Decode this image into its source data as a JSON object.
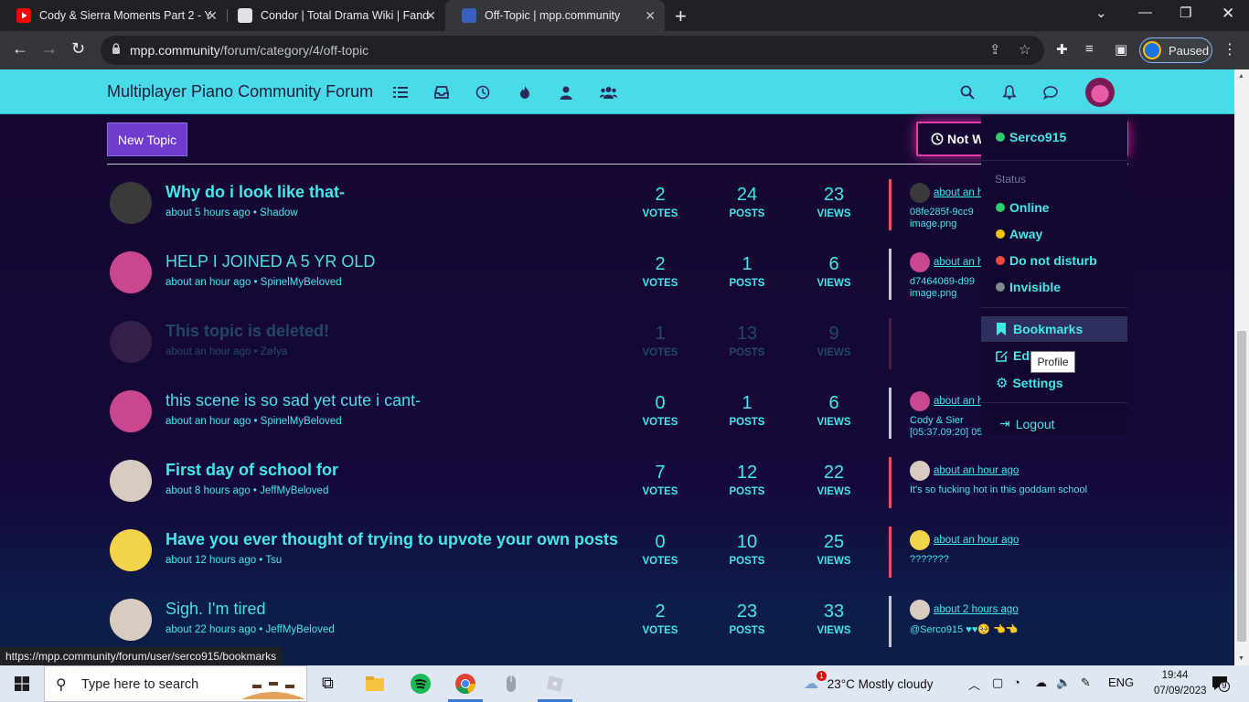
{
  "browser": {
    "tabs": [
      {
        "title": "Cody & Sierra Moments Part 2 - Y",
        "favicon": "youtube-icon",
        "active": false
      },
      {
        "title": "Condor | Total Drama Wiki | Fand",
        "favicon": "fandom-icon",
        "active": false
      },
      {
        "title": "Off-Topic | mpp.community",
        "favicon": "mpp-icon",
        "active": true
      }
    ],
    "url_host": "mpp.community",
    "url_path": "/forum/category/4/off-topic",
    "profile_label": "Paused",
    "status_url": "https://mpp.community/forum/user/serco915/bookmarks"
  },
  "site": {
    "brand": "Multiplayer Piano Community Forum",
    "accent": "#4adbe9",
    "link_color": "#45e6e8"
  },
  "toolbar": {
    "new_topic": "New Topic",
    "watch_label": "Not W"
  },
  "topics": [
    {
      "title": "Why do i look like that-",
      "meta": "about 5 hours ago • Shadow",
      "votes": "2",
      "posts": "24",
      "views": "23",
      "bar": "#e8505b",
      "last_time": "about an h",
      "last_text1": "08fe285f-9cc9",
      "last_text2": "image.png",
      "avatar": "#3a3a3a"
    },
    {
      "title": "HELP I JOINED A 5 YR OLD",
      "meta": "about an hour ago • SpinelMyBeloved",
      "votes": "2",
      "posts": "1",
      "views": "6",
      "bar": "#c8c8d4",
      "last_time": "about an h",
      "last_text1": "d7464069-d99",
      "last_text2": "image.png",
      "avatar": "#c8478f"
    },
    {
      "title": "This topic is deleted!",
      "meta": "about an hour ago • Zøfya",
      "votes": "1",
      "posts": "13",
      "views": "9",
      "bar": "#e8505b",
      "last_time": "",
      "last_text1": "",
      "last_text2": "",
      "avatar": "#8a5a7a"
    },
    {
      "title": "this scene is so sad yet cute i cant-",
      "meta": "about an hour ago • SpinelMyBeloved",
      "votes": "0",
      "posts": "1",
      "views": "6",
      "bar": "#c8c8d4",
      "last_time": "about an h",
      "last_text1": "Cody & Sier",
      "last_text2": "[05:37.09:20] 05",
      "avatar": "#c8478f"
    },
    {
      "title": "First day of school for",
      "meta": "about 8 hours ago • JeffMyBeloved",
      "votes": "7",
      "posts": "12",
      "views": "22",
      "bar": "#e8505b",
      "last_time": "about an hour ago",
      "last_text1": "It's so fucking hot in this goddam school",
      "last_text2": "",
      "avatar": "#d9cbc0"
    },
    {
      "title": "Have you ever thought of trying to upvote your own posts",
      "meta": "about 12 hours ago • Tsu",
      "votes": "0",
      "posts": "10",
      "views": "25",
      "bar": "#e8505b",
      "last_time": "about an hour ago",
      "last_text1": "???????",
      "last_text2": "",
      "avatar": "#f2d34a"
    },
    {
      "title": "Sigh. I'm tired",
      "meta": "about 22 hours ago • JeffMyBeloved",
      "votes": "2",
      "posts": "23",
      "views": "33",
      "bar": "#c8c8d4",
      "last_time": "about 2 hours ago",
      "last_text1": "@Serco915 ♥♥🥺 👈👈",
      "last_text2": "",
      "avatar": "#d9cbc0"
    }
  ],
  "stat_labels": {
    "votes": "VOTES",
    "posts": "POSTS",
    "views": "VIEWS"
  },
  "menu": {
    "username": "Serco915",
    "status_heading": "Status",
    "online": "Online",
    "away": "Away",
    "dnd": "Do not disturb",
    "invisible": "Invisible",
    "bookmarks": "Bookmarks",
    "edit": "Edi",
    "settings": "Settings",
    "logout": "Logout",
    "tooltip": "Profile"
  },
  "taskbar": {
    "search_placeholder": "Type here to search",
    "weather": "23°C  Mostly cloudy",
    "weather_badge": "1",
    "lang": "ENG",
    "time": "19:44",
    "date": "07/09/2023",
    "notif_count": "9"
  }
}
